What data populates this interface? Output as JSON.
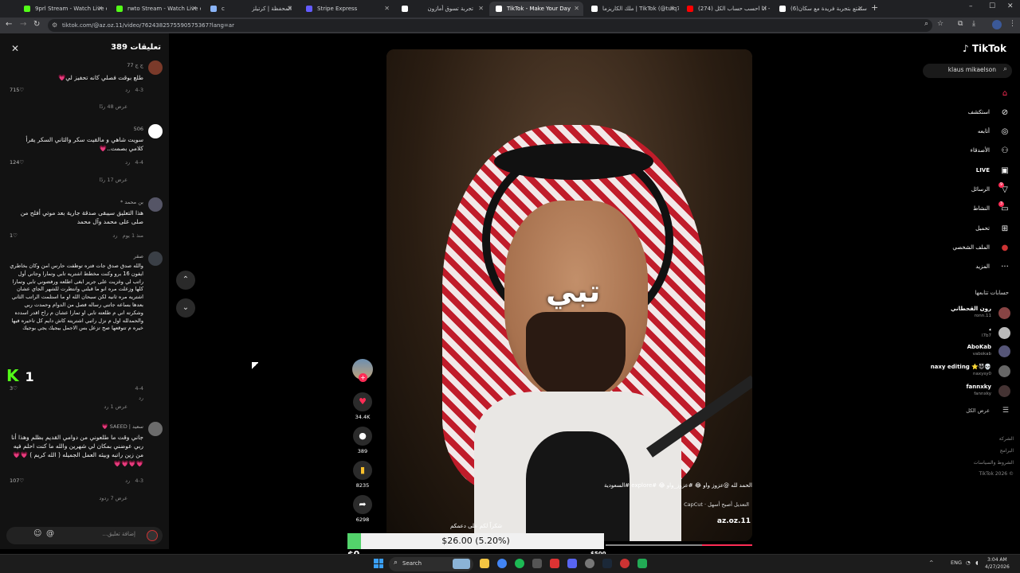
{
  "browser": {
    "tabs": [
      {
        "label": "9prl Stream - Watch Live on Ki",
        "color": "#53fc18"
      },
      {
        "label": "rwto Stream - Watch Live on Ki",
        "color": "#53fc18"
      },
      {
        "label": "c",
        "color": "#8ab4f8"
      },
      {
        "label": "المحفظة | كرتيلز",
        "color": "#f5a623"
      },
      {
        "label": "Stripe Express",
        "color": "#635bff"
      },
      {
        "label": "تجربة تسوق أمازون",
        "color": "#ffffff"
      },
      {
        "label": "TikTok - Make Your Day",
        "color": "#ffffff"
      },
      {
        "label": "ملك الكاريزما | TikTok (@tuiq77)",
        "color": "#ffffff"
      },
      {
        "label": "(274) انا احسب حساب الكل - be...",
        "color": "#ff0000"
      },
      {
        "label": "(6)استمتع بتجربة فريدة مع سكان...",
        "color": "#ffffff"
      }
    ],
    "url": "tiktok.com/@az.oz.11/video/7624382575590575367?lang=ar"
  },
  "comments": {
    "title": "تعليقات 389",
    "input_placeholder": "إضافة تعليق...",
    "items": [
      {
        "name": "ج ج 77",
        "text": "طلع بوقت فصلي كانه تحفيز لي💗",
        "date": "4-3",
        "reply": "رد",
        "likes": "715♡",
        "view_replies": "عرض 48 ردًا"
      },
      {
        "name": "506",
        "text": "سويت شاهي و مالقيت سكر والثاني السكر يقرأ كلامي بصمت..💗",
        "date": "4-4",
        "reply": "رد",
        "likes": "124♡",
        "view_replies": "عرض 17 ردًا"
      },
      {
        "name": "بن محمد *",
        "text": "هذا التعليق سيبقى صدقة جارية بعد موتي أفلح من صلى على محمد وآل محمد",
        "date": "منذ 1 يوم",
        "reply": "رد",
        "likes": "1♡",
        "view_replies": ""
      },
      {
        "name": "صقر",
        "text": "والله صدق صدق جات فتره توظفت حارس امن وكان بخاطري ايفون 16 برو وكنت مخطط اشتريه تابي وتمارا وجاني أول راتب لي وغزيت على جرير ابغى اطلعه ورفضوني تابي وتمارا كلها وزعلت مره انو ما قبلني وانتظرت للشهر الجاي عشان اشتريه مره ثانيه لكن سبحان الله او ما استلمت الراتب الثاني بعدها بساعه جاتني رساله فصل من الدوام وحمدت ربي وشكرته اني م طلعته تابي او تمارا عشان م راح اقدر اسدده والحمدلله اول م نزل راتبي اشتريته كاش دايم كل تاخيره فيها خيره م تتوقعها صح تزعل بس الاجمل بيجيك يجي بوجيك",
        "date": "4-4",
        "reply": "رد",
        "likes": "3♡",
        "view_replies": "عرض 1 رد"
      },
      {
        "name": "سعيد | SAEED 💗",
        "text": "جاني وقت ما طلعوني من دوامي القديم بظلم وهذا أنا ربي عوضني بمكان لي شهرين والله ما كنت احلم فيه من زين راتبه وبيئه العمل الجميله ( الله كريم ) 💗💗💗💗💗💗",
        "date": "4-3",
        "reply": "رد",
        "likes": "107♡",
        "view_replies": "عرض 7 ردود"
      }
    ]
  },
  "kick_badge": {
    "logo": "K",
    "count": "1"
  },
  "video": {
    "caption": "تبي",
    "capcut": "CapCut · التعديل أصبح أسهل",
    "username": "az.oz.11",
    "description": "الحمد لله @عزوز واو 😂 #عزوز_واو 😂 #explore #السعودية",
    "progress": 0.34
  },
  "actions": {
    "likes": "34.4K",
    "comments": "389",
    "saves": "8235",
    "shares": "6298"
  },
  "donation": {
    "title": "شكراً لكم على دعمكم",
    "text": "$26.00 (5.20%)",
    "fraction": 0.052,
    "min": "$0",
    "max": "$500"
  },
  "sidebar": {
    "logo": "TikTok",
    "search_value": "klaus mikaelson",
    "nav": [
      {
        "label": "",
        "icon": "⌂"
      },
      {
        "label": "استكشف",
        "icon": "⊘"
      },
      {
        "label": "أتابعه",
        "icon": "◎"
      },
      {
        "label": "الأصدقاء",
        "icon": "⚇"
      },
      {
        "label": "LIVE",
        "icon": "▣"
      },
      {
        "label": "الرسائل",
        "icon": "▽",
        "badge": "9"
      },
      {
        "label": "النشاط",
        "icon": "▭",
        "badge": "3"
      },
      {
        "label": "تحميل",
        "icon": "⊞"
      },
      {
        "label": "الملف الشخصي",
        "icon": "●"
      },
      {
        "label": "المزيد",
        "icon": "···"
      }
    ],
    "following_title": "حسابات تتابعها",
    "following": [
      {
        "name": "رون القحطاني",
        "handle": "ronn.11"
      },
      {
        "name": "ﯾ",
        "handle": "l7b7"
      },
      {
        "name": "AboKab",
        "handle": "vabokab"
      },
      {
        "name": "naxy editing ⭐😈💀",
        "handle": "naxysy0"
      },
      {
        "name": "fannxky",
        "handle": "fannxky"
      }
    ],
    "see_all": "عرض الكل",
    "footer": [
      "الشركة",
      "البرامج",
      "الشروط والسياسات",
      "TikTok 2026 ©"
    ]
  },
  "taskbar": {
    "search_label": "Search",
    "lang": "ENG",
    "time": "3:04 AM",
    "date": "4/27/2026"
  }
}
